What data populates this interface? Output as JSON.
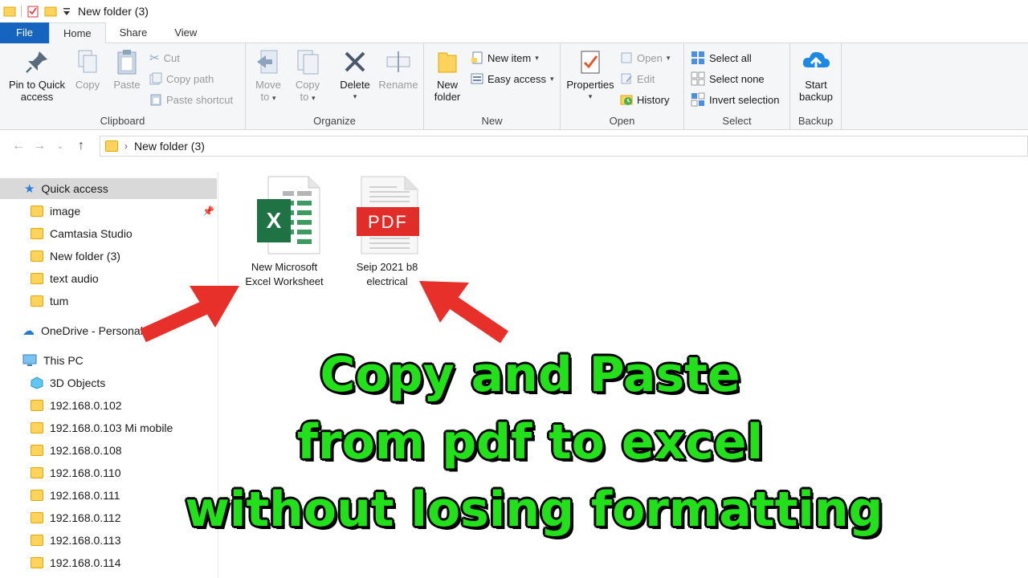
{
  "window": {
    "title": "New folder (3)"
  },
  "tabs": [
    {
      "label": "File"
    },
    {
      "label": "Home"
    },
    {
      "label": "Share"
    },
    {
      "label": "View"
    }
  ],
  "ribbon": {
    "clipboard": {
      "label": "Clipboard",
      "pin_line1": "Pin to Quick",
      "pin_line2": "access",
      "copy": "Copy",
      "paste": "Paste",
      "cut": "Cut",
      "copy_path": "Copy path",
      "paste_shortcut": "Paste shortcut"
    },
    "organize": {
      "label": "Organize",
      "move_line1": "Move",
      "move_line2": "to",
      "copy_line1": "Copy",
      "copy_line2": "to",
      "delete": "Delete",
      "rename": "Rename"
    },
    "new": {
      "label": "New",
      "folder_line1": "New",
      "folder_line2": "folder",
      "new_item": "New item",
      "easy_access": "Easy access"
    },
    "open": {
      "label": "Open",
      "properties": "Properties",
      "open": "Open",
      "edit": "Edit",
      "history": "History"
    },
    "select": {
      "label": "Select",
      "select_all": "Select all",
      "select_none": "Select none",
      "invert": "Invert selection"
    },
    "backup": {
      "label": "Backup",
      "start_line1": "Start",
      "start_line2": "backup"
    }
  },
  "address": {
    "path": "New folder (3)"
  },
  "sidebar": {
    "quick_access": "Quick access",
    "quick_items": [
      "image",
      "Camtasia Studio",
      "New folder (3)",
      "text audio",
      "tum"
    ],
    "onedrive": "OneDrive - Personal",
    "this_pc": "This PC",
    "pc_items": [
      "3D Objects",
      "192.168.0.102",
      "192.168.0.103 Mi mobile",
      "192.168.0.108",
      "192.168.0.110",
      "192.168.0.111",
      "192.168.0.112",
      "192.168.0.113",
      "192.168.0.114"
    ]
  },
  "files": [
    {
      "line1": "New Microsoft",
      "line2": "Excel Worksheet",
      "icon": "excel-icon"
    },
    {
      "line1": "Seip 2021 b8",
      "line2": "electrical",
      "icon": "pdf-icon"
    }
  ],
  "icon_badges": {
    "excel_letter": "X",
    "pdf_label": "PDF"
  },
  "caption": {
    "line1": "Copy and Paste",
    "line2": "from pdf to excel",
    "line3": "without losing formatting"
  },
  "colors": {
    "file_tab": "#1565c0",
    "caption_green": "#22e01a",
    "arrow_red": "#e8302a",
    "excel_green": "#1f7244",
    "pdf_red": "#e12d2a"
  }
}
